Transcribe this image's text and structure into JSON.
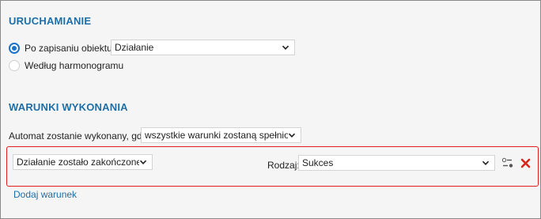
{
  "launch": {
    "title": "URUCHAMIANIE",
    "option_after_save": "Po zapisaniu obiektu",
    "option_after_save_selected": true,
    "object_select_value": "Działanie",
    "option_schedule": "Według harmonogramu",
    "option_schedule_selected": false
  },
  "conditions": {
    "title": "WARUNKI WYKONANIA",
    "automat_label": "Automat zostanie wykonany, gdy",
    "automat_select_value": "wszystkie warunki zostaną spełnione",
    "rows": [
      {
        "condition_value": "Działanie zostało zakończone",
        "kind_label": "Rodzaj:",
        "kind_value": "Sukces"
      }
    ],
    "add_condition_label": "Dodaj warunek"
  },
  "icons": {
    "settings": "toggle-settings-icon",
    "delete": "close-x-icon",
    "dropdown": "chevron-down-icon"
  },
  "colors": {
    "accent": "#1d6fa8",
    "radio": "#1a73c9",
    "highlight_border": "#e02020",
    "delete": "#d9261c"
  }
}
